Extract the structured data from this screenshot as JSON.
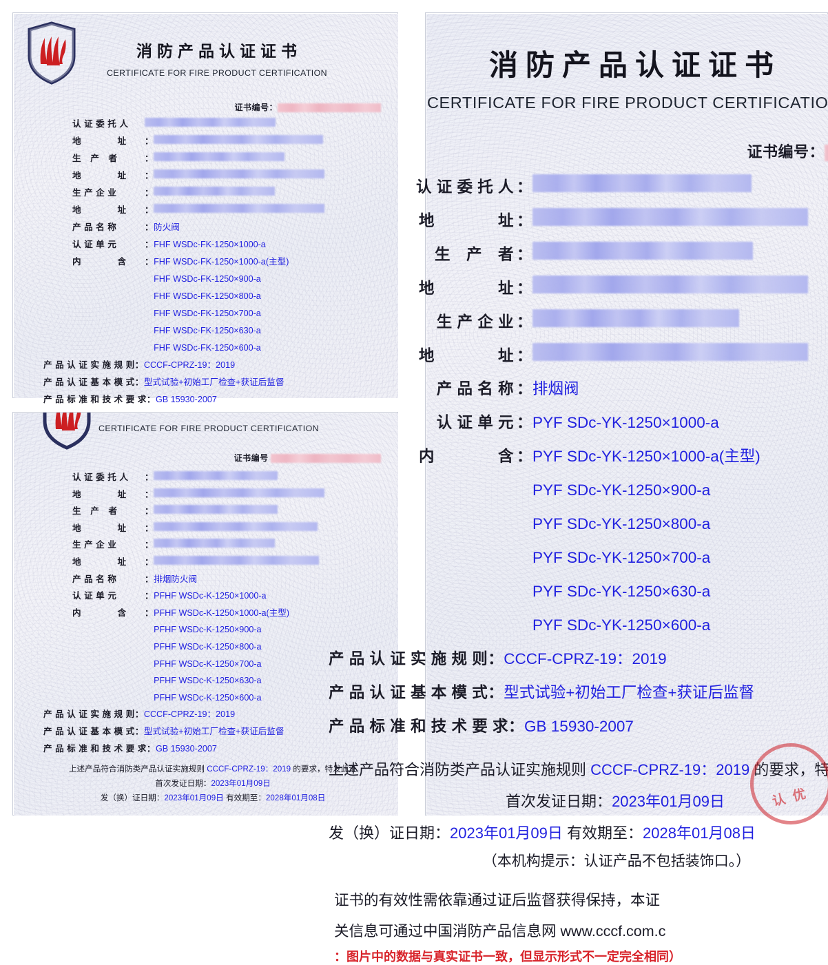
{
  "common": {
    "title_cn": "消防产品认证证书",
    "title_en": "CERTIFICATE FOR FIRE PRODUCT CERTIFICATION",
    "cert_no_label": "证书编号：",
    "cert_no_label_plain": "证书编号",
    "logo_name": "cccf-fire-shield-logo",
    "labels": {
      "applicant": "认 证 委 托 人",
      "address": "地　　　　址",
      "manufacturer": "生　产　者",
      "factory": "生 产 企 业",
      "product_name": "产 品 名 称",
      "cert_unit": "认 证 单 元",
      "includes": "内　　　　含",
      "rule": "产 品 认 证 实 施 规 则",
      "mode": "产 品 认 证 基 本 模 式",
      "standard": "产 品 标 准 和 技 术 要 求"
    },
    "colon": "：",
    "rule_value": "CCCF-CPRZ-19：2019",
    "mode_value": "型式试验+初始工厂检查+获证后监督",
    "standard_value": "GB 15930-2007",
    "conformity_prefix": "上述产品符合消防类产品认证实施规则 ",
    "conformity_suffix": " 的要求，特发此证",
    "first_issue_label": "首次发证日期：",
    "first_issue_value": "2023年01月09日",
    "reissue_label": "发（换）证日期：",
    "reissue_value": "2023年01月09日",
    "valid_label": "有效期至：",
    "valid_value": "2028年01月08日",
    "redaction_placeholder": "[已遮挡]"
  },
  "certA": {
    "name": "fire-damper-certificate",
    "product_name": "防火阀",
    "cert_unit": "FHF WSDc-FK-1250×1000-a",
    "models": [
      "FHF WSDc-FK-1250×1000-a(主型)",
      "FHF WSDc-FK-1250×900-a",
      "FHF WSDc-FK-1250×800-a",
      "FHF WSDc-FK-1250×700-a",
      "FHF WSDc-FK-1250×630-a",
      "FHF WSDc-FK-1250×600-a"
    ]
  },
  "certB": {
    "name": "smoke-exhaust-fire-damper-certificate",
    "product_name": "排烟防火阀",
    "cert_unit": "PFHF WSDc-K-1250×1000-a",
    "models": [
      "PFHF WSDc-K-1250×1000-a(主型)",
      "PFHF WSDc-K-1250×900-a",
      "PFHF WSDc-K-1250×800-a",
      "PFHF WSDc-K-1250×700-a",
      "PFHF WSDc-K-1250×630-a",
      "PFHF WSDc-K-1250×600-a"
    ]
  },
  "certC": {
    "name": "smoke-exhaust-valve-certificate",
    "product_name": "排烟阀",
    "cert_unit": "PYF SDc-YK-1250×1000-a",
    "models": [
      "PYF SDc-YK-1250×1000-a(主型)",
      "PYF SDc-YK-1250×900-a",
      "PYF SDc-YK-1250×800-a",
      "PYF SDc-YK-1250×700-a",
      "PYF SDc-YK-1250×630-a",
      "PYF SDc-YK-1250×600-a"
    ],
    "agency_note": "（本机构提示：认证产品不包括装饰口。）",
    "legal_line1": "证书的有效性需依靠通过证后监督获得保持，本证",
    "legal_line2": "关信息可通过中国消防产品信息网 www.cccf.com.c",
    "red_note": "：图片中的数据与真实证书一致，但显示形式不一定完全相同）",
    "stamp_text": "认 优"
  },
  "colors": {
    "value_blue": "#2222e0",
    "label_dark": "#1c1c28",
    "red_note": "#d8232a",
    "shield_navy": "#2a2f5e",
    "flame_red": "#cc1f22",
    "paper": "#eff0f7"
  }
}
